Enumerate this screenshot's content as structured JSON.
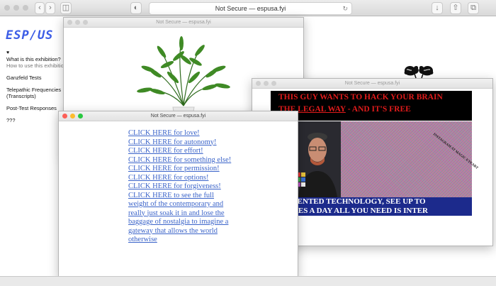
{
  "browser": {
    "address": "Not Secure — espusa.fyi"
  },
  "site": {
    "logo": "ESP/US",
    "nav": [
      {
        "label": "What is this exhibition?",
        "sub": "How to use this exhibition?"
      },
      {
        "label": "Ganzfeld Tests"
      },
      {
        "label": "Telepathic Frequencies (Transcripts)"
      },
      {
        "label": "Post-Test Responses"
      },
      {
        "label": "???"
      }
    ]
  },
  "plant_window": {
    "title": "Not Secure — espusa.fyi"
  },
  "ad_window": {
    "title": "Not Secure — espusa.fyi",
    "headline1": "THIS GUY WANTS TO HACK YOUR BRAIN",
    "headline2a": "THE LEGAL WAY",
    "headline2b": " - AND IT'S FREE",
    "bottom1": "G PATENTED TECHNOLOGY, SEE UP TO",
    "bottom2": "MAGES A DAY  ALL YOU NEED IS INTER",
    "rotated": "INSTAGRAM AT MAGIC EYEART"
  },
  "links_window": {
    "title": "Not Secure — espusa.fyi",
    "links": [
      "CLICK HERE for love!",
      "CLICK HERE for autonomy!",
      "CLICK HERE for effort!",
      "CLICK HERE for something else!",
      "CLICK HERE for permission!",
      "CLICK HERE for options!",
      "CLICK HERE for forgiveness!",
      "CLICK HERE to see the full weight of the contemporary and really just soak it in and lose the baggage of nostalgia to imagine a gateway that allows the world otherwise"
    ]
  },
  "colors": {
    "accent": "#3b5ce6",
    "link": "#3a63c9",
    "ad_red": "#e11b1b",
    "ad_blue": "#1c2a8c"
  }
}
